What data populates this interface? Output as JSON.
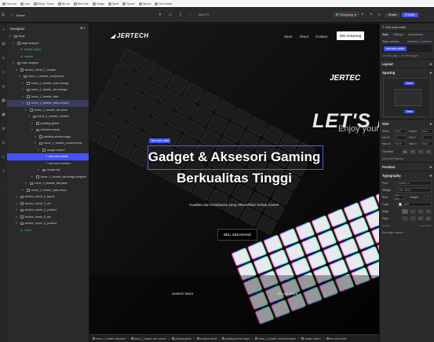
{
  "bookmarks": [
    "How tos",
    "Jina",
    "DeepL Transl",
    "Bri ine",
    "Blue Bar",
    "Image",
    "Sport",
    "Sport2",
    "Sports",
    "New folder"
  ],
  "toolbar": {
    "home": "Home",
    "px": "1084 PX",
    "design_label": "Designing",
    "share": "Share",
    "publish": "Publish"
  },
  "navigator": {
    "title": "Navigator",
    "items": [
      {
        "label": "Body",
        "depth": 0,
        "kind": "box"
      },
      {
        "label": "page-wrapper",
        "depth": 1,
        "kind": "box"
      },
      {
        "label": "Global Styles",
        "depth": 2,
        "kind": "green"
      },
      {
        "label": "navbar",
        "depth": 2,
        "kind": "green"
      },
      {
        "label": "main-wrapper",
        "depth": 1,
        "kind": "box"
      },
      {
        "label": "section_home_1_header",
        "depth": 2,
        "kind": "box"
      },
      {
        "label": "home_1_header_component",
        "depth": 3,
        "kind": "box"
      },
      {
        "label": "home_1_header_auto-change",
        "depth": 4,
        "kind": "box"
      },
      {
        "label": "home_1_header_tab-change",
        "depth": 4,
        "kind": "box"
      },
      {
        "label": "home_1_header_tabs",
        "depth": 4,
        "kind": "box"
      },
      {
        "label": "home_1_header_tabs-content",
        "depth": 4,
        "kind": "box",
        "state": "hl"
      },
      {
        "label": "home_1_header_tab-pane",
        "depth": 5,
        "kind": "box"
      },
      {
        "label": "home_1_header_content",
        "depth": 6,
        "kind": "box"
      },
      {
        "label": "padding-global",
        "depth": 7,
        "kind": "box"
      },
      {
        "label": "container-small",
        "depth": 7,
        "kind": "box"
      },
      {
        "label": "padding-section-large",
        "depth": 8,
        "kind": "box"
      },
      {
        "label": "home_1_header_content-wrap",
        "depth": 8,
        "kind": "box"
      },
      {
        "label": "margin-bottom",
        "depth": 9,
        "kind": "box"
      },
      {
        "label": "text-color-white",
        "depth": 10,
        "kind": "text",
        "state": "sel"
      },
      {
        "label": "text-size-medium",
        "depth": 10,
        "kind": "text"
      },
      {
        "label": "margin-top",
        "depth": 9,
        "kind": "box"
      },
      {
        "label": "home_1_header_tab-image-wrapper",
        "depth": 7,
        "kind": "box"
      },
      {
        "label": "home_1_header_tab-pane",
        "depth": 5,
        "kind": "box"
      },
      {
        "label": "home_1_header_tabs-menu",
        "depth": 4,
        "kind": "box"
      },
      {
        "label": "section_home_2_layout",
        "depth": 2,
        "kind": "box"
      },
      {
        "label": "section_home_3_cta",
        "depth": 2,
        "kind": "box"
      },
      {
        "label": "section_home_4_product",
        "depth": 2,
        "kind": "box"
      },
      {
        "label": "section_home_5_cta",
        "depth": 2,
        "kind": "box"
      },
      {
        "label": "section_home_6_product",
        "depth": 2,
        "kind": "box"
      },
      {
        "label": "footer",
        "depth": 2,
        "kind": "green"
      }
    ]
  },
  "site": {
    "logo": "JERTECH",
    "menu": [
      "Store",
      "About",
      "Contact"
    ],
    "cta_top": "Beli Sekarang",
    "hero_title_line1": "Gadget & Aksesori Gaming",
    "hero_title_line2": "Berkualitas Tinggi",
    "hero_subtitle": "Kualitas dan Ketahanan yang Dibutuhkan Setiap Gamer",
    "hero_button": "BELI SEKARANG",
    "bg_lets": "LET'S PLA",
    "bg_enjoy": "Enjoy your g",
    "bg_logo": "JERTEC",
    "caption_left": "Jertech Store",
    "caption_right": "RL uel Store"
  },
  "canvas": {
    "selected_tag": "Text color white"
  },
  "statusbar": {
    "crumbs": [
      "home_1_header_tab-pane",
      "home_1_header_tab-content",
      "padding-global",
      "container-small",
      "padding-section-large",
      "home_1_header_content-wrapper",
      "margin-bottom",
      "text-color-white"
    ]
  },
  "panel": {
    "selector": "text-color-white",
    "tabs": [
      "Style",
      "Settings",
      "Interactions"
    ],
    "style_selector_label": "Style selector",
    "inheriting": "Inheriting 1 selector",
    "selector_chip": "text-color-white",
    "on_page": "4 on this page, 1 on other pages",
    "sections": {
      "layout": "Layout",
      "spacing": "Spacing",
      "size": "Size",
      "position": "Position",
      "typography": "Typography"
    },
    "spacing_top": "0rem",
    "spacing_bottom": "0rem",
    "size_fields": [
      [
        "Width",
        "Auto",
        "Height",
        "Auto"
      ],
      [
        "Min W",
        "0",
        "Min H",
        "0"
      ],
      [
        "Max W",
        "None",
        "Max H",
        "None"
      ]
    ],
    "overflow_label": "Overflow",
    "more_size": "More size options",
    "font_label": "Font",
    "font_value": "system-ui",
    "weight_label": "Weight",
    "weight_value": "700 - Bold",
    "size_label": "Size",
    "size_value": "3.5 rem",
    "height_label": "Height",
    "height_value": "1.2",
    "color_label": "Color",
    "color_value": "white",
    "align_label": "Align",
    "style_label": "Style",
    "italicize": "Italicize",
    "decoration": "Decoration",
    "more_type": "More type options"
  }
}
